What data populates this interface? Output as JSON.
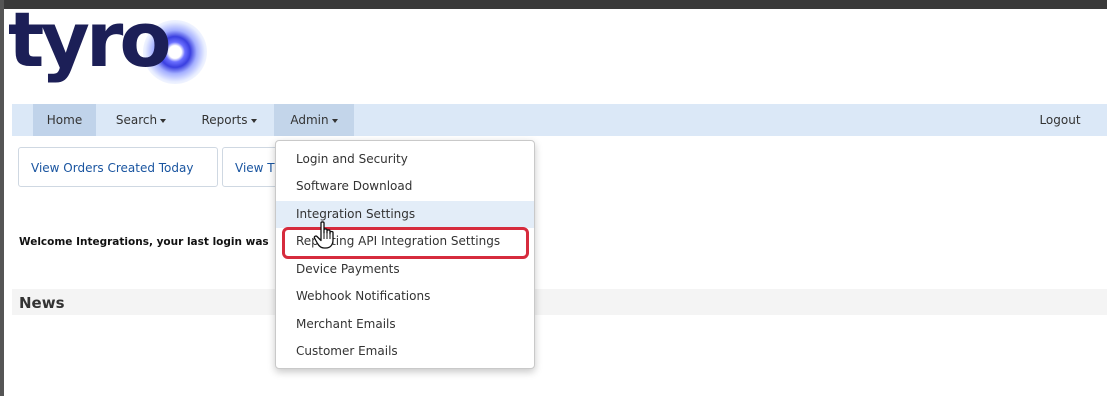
{
  "logo": {
    "text": "tyro"
  },
  "navbar": {
    "items": [
      {
        "label": "Home",
        "has_caret": false
      },
      {
        "label": "Search",
        "has_caret": true
      },
      {
        "label": "Reports",
        "has_caret": true
      },
      {
        "label": "Admin",
        "has_caret": true
      }
    ],
    "logout_label": "Logout"
  },
  "quick_links": [
    {
      "label": "View Orders Created Today"
    },
    {
      "label": "View T"
    }
  ],
  "welcome_text": "Welcome Integrations, your last login was",
  "news_title": "News",
  "admin_menu": {
    "items": [
      {
        "label": "Login and Security"
      },
      {
        "label": "Software Download"
      },
      {
        "label": "Integration Settings"
      },
      {
        "label": "Reporting API Integration Settings"
      },
      {
        "label": "Device Payments"
      },
      {
        "label": "Webhook Notifications"
      },
      {
        "label": "Merchant Emails"
      },
      {
        "label": "Customer Emails"
      }
    ],
    "hovered_index": 2,
    "highlighted_index": 3
  },
  "colors": {
    "navbar_bg": "#dbe8f7",
    "logo_color": "#1c1f57",
    "link_color": "#1a55a0",
    "highlight_border": "#d62b3d"
  },
  "icons": {
    "cursor": "hand-pointer-icon",
    "caret": "caret-down-icon"
  }
}
